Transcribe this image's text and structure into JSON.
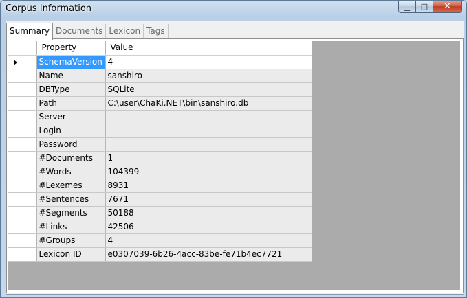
{
  "window": {
    "title": "Corpus Information"
  },
  "tabs": [
    "Summary",
    "Documents",
    "Lexicon",
    "Tags"
  ],
  "grid": {
    "columns": [
      "Property",
      "Value"
    ],
    "rows": [
      {
        "property": "SchemaVersion",
        "value": "4"
      },
      {
        "property": "Name",
        "value": "sanshiro"
      },
      {
        "property": "DBType",
        "value": "SQLite"
      },
      {
        "property": "Path",
        "value": "C:\\user\\ChaKi.NET\\bin\\sanshiro.db"
      },
      {
        "property": "Server",
        "value": ""
      },
      {
        "property": "Login",
        "value": ""
      },
      {
        "property": "Password",
        "value": ""
      },
      {
        "property": "#Documents",
        "value": "1"
      },
      {
        "property": "#Words",
        "value": "104399"
      },
      {
        "property": "#Lexemes",
        "value": "8931"
      },
      {
        "property": "#Sentences",
        "value": "7671"
      },
      {
        "property": "#Segments",
        "value": "50188"
      },
      {
        "property": "#Links",
        "value": "42506"
      },
      {
        "property": "#Groups",
        "value": "4"
      },
      {
        "property": "Lexicon ID",
        "value": "e0307039-6b26-4acc-83be-fe71b4ec7721"
      }
    ]
  },
  "colors": {
    "selection": "#3399ff",
    "grid_background": "#ababab"
  }
}
